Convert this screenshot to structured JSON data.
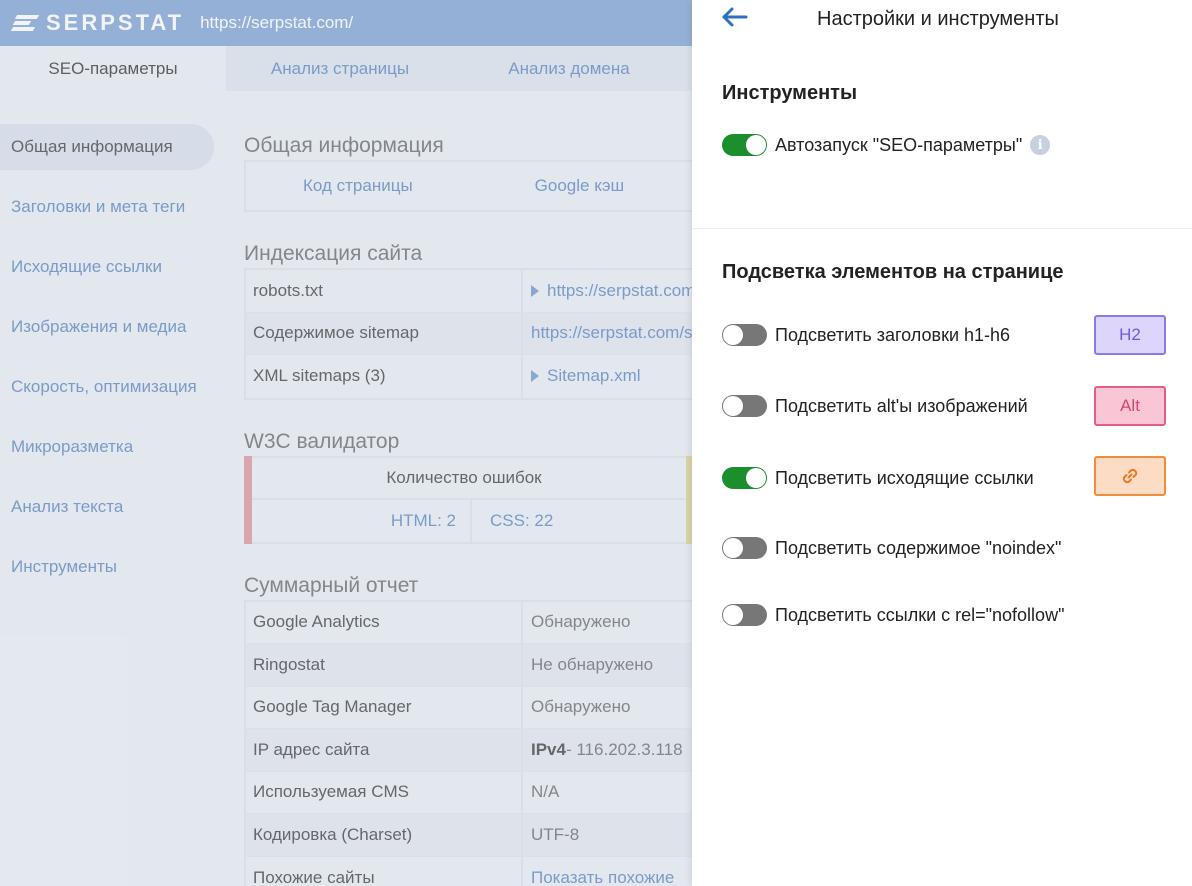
{
  "header": {
    "logo_text": "SERPSTAT",
    "url": "https://serpstat.com/"
  },
  "tabs": [
    {
      "label": "SEO-параметры",
      "active": true
    },
    {
      "label": "Анализ страницы",
      "active": false
    },
    {
      "label": "Анализ домена",
      "active": false
    }
  ],
  "sidebar": {
    "items": [
      {
        "label": "Общая информация",
        "active": true
      },
      {
        "label": "Заголовки и мета теги"
      },
      {
        "label": "Исходящие ссылки"
      },
      {
        "label": "Изображения и медиа"
      },
      {
        "label": "Скорость, оптимизация"
      },
      {
        "label": "Микроразметка"
      },
      {
        "label": "Анализ текста"
      },
      {
        "label": "Инструменты"
      }
    ]
  },
  "general": {
    "title": "Общая информация",
    "link1": "Код страницы",
    "link2": "Google кэш"
  },
  "indexing": {
    "title": "Индексация сайта",
    "rows": [
      {
        "label": "robots.txt",
        "value": "https://serpstat.com/robots.txt",
        "arrow": true
      },
      {
        "label": "Содержимое sitemap",
        "value": "https://serpstat.com/sitemap.xml",
        "arrow": false
      },
      {
        "label": "XML sitemaps (3)",
        "value": "Sitemap.xml",
        "arrow": true
      }
    ]
  },
  "w3c": {
    "title": "W3C валидатор",
    "head": "Количество ошибок",
    "html": "HTML: 2",
    "css": "CSS: 22"
  },
  "summary": {
    "title": "Суммарный отчет",
    "rows": [
      {
        "label": "Google Analytics",
        "value": "Обнаружено"
      },
      {
        "label": "Ringostat",
        "value": "Не обнаружено"
      },
      {
        "label": "Google Tag Manager",
        "value": "Обнаружено"
      },
      {
        "label": "IP адрес сайта",
        "value_bold": "IPv4",
        "value": " - 116.202.3.118"
      },
      {
        "label": "Используемая CMS",
        "value": "N/A"
      },
      {
        "label": "Кодировка (Charset)",
        "value": "UTF-8"
      },
      {
        "label": "Похожие сайты",
        "value": "Показать похожие"
      }
    ]
  },
  "panel": {
    "title": "Настройки и инструменты",
    "tools_title": "Инструменты",
    "autostart_label": "Автозапуск \"SEO-параметры\"",
    "autostart_on": true,
    "info_glyph": "i",
    "highlight_title": "Подсветка элементов на странице",
    "options": [
      {
        "label": "Подсветить заголовки h1-h6",
        "on": false,
        "badge": "H2"
      },
      {
        "label": "Подсветить alt'ы изображений",
        "on": false,
        "badge": "Alt"
      },
      {
        "label": "Подсветить исходящие ссылки",
        "on": true,
        "badge": "link-icon"
      },
      {
        "label": "Подсветить содержимое \"noindex\"",
        "on": false
      },
      {
        "label": "Подсветить ссылки с rel=\"nofollow\"",
        "on": false
      }
    ]
  },
  "colors": {
    "toggle_on": "#1a8f2c",
    "toggle_off": "#777777",
    "accent_blue": "#6e94c8",
    "topbar": "#8faed8"
  }
}
